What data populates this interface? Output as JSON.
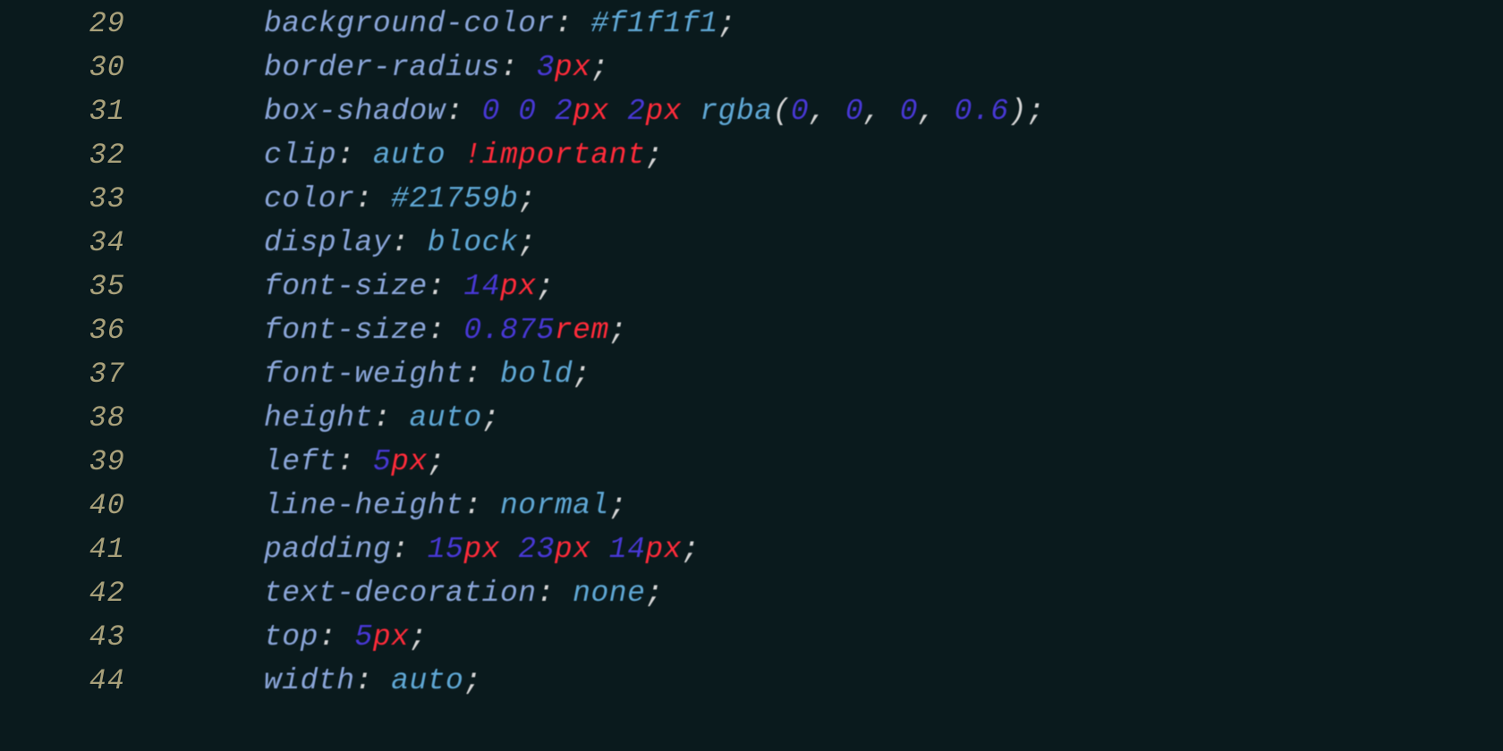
{
  "lines": [
    {
      "num": "29",
      "prop": "background-color",
      "tokens": [
        {
          "t": "#f1f1f1",
          "c": "v"
        }
      ]
    },
    {
      "num": "30",
      "prop": "border-radius",
      "tokens": [
        {
          "t": "3",
          "c": "n"
        },
        {
          "t": "px",
          "c": "u"
        }
      ]
    },
    {
      "num": "31",
      "prop": "box-shadow",
      "tokens": [
        {
          "t": "0",
          "c": "n"
        },
        {
          "t": " ",
          "c": "s"
        },
        {
          "t": "0",
          "c": "n"
        },
        {
          "t": " ",
          "c": "s"
        },
        {
          "t": "2",
          "c": "n"
        },
        {
          "t": "px",
          "c": "u"
        },
        {
          "t": " ",
          "c": "s"
        },
        {
          "t": "2",
          "c": "n"
        },
        {
          "t": "px",
          "c": "u"
        },
        {
          "t": " ",
          "c": "s"
        },
        {
          "t": "rgba",
          "c": "f"
        },
        {
          "t": "(",
          "c": "s"
        },
        {
          "t": "0",
          "c": "n"
        },
        {
          "t": ", ",
          "c": "s"
        },
        {
          "t": "0",
          "c": "n"
        },
        {
          "t": ", ",
          "c": "s"
        },
        {
          "t": "0",
          "c": "n"
        },
        {
          "t": ", ",
          "c": "s"
        },
        {
          "t": "0.6",
          "c": "n"
        },
        {
          "t": ")",
          "c": "s"
        }
      ]
    },
    {
      "num": "32",
      "prop": "clip",
      "tokens": [
        {
          "t": "auto",
          "c": "v"
        },
        {
          "t": " ",
          "c": "s"
        },
        {
          "t": "!important",
          "c": "u"
        }
      ]
    },
    {
      "num": "33",
      "prop": "color",
      "tokens": [
        {
          "t": "#21759b",
          "c": "v"
        }
      ]
    },
    {
      "num": "34",
      "prop": "display",
      "tokens": [
        {
          "t": "block",
          "c": "v"
        }
      ]
    },
    {
      "num": "35",
      "prop": "font-size",
      "tokens": [
        {
          "t": "14",
          "c": "n"
        },
        {
          "t": "px",
          "c": "u"
        }
      ]
    },
    {
      "num": "36",
      "prop": "font-size",
      "tokens": [
        {
          "t": "0.875",
          "c": "n"
        },
        {
          "t": "rem",
          "c": "u"
        }
      ]
    },
    {
      "num": "37",
      "prop": "font-weight",
      "tokens": [
        {
          "t": "bold",
          "c": "v"
        }
      ]
    },
    {
      "num": "38",
      "prop": "height",
      "tokens": [
        {
          "t": "auto",
          "c": "v"
        }
      ]
    },
    {
      "num": "39",
      "prop": "left",
      "tokens": [
        {
          "t": "5",
          "c": "n"
        },
        {
          "t": "px",
          "c": "u"
        }
      ]
    },
    {
      "num": "40",
      "prop": "line-height",
      "tokens": [
        {
          "t": "normal",
          "c": "v"
        }
      ]
    },
    {
      "num": "41",
      "prop": "padding",
      "tokens": [
        {
          "t": "15",
          "c": "n"
        },
        {
          "t": "px",
          "c": "u"
        },
        {
          "t": " ",
          "c": "s"
        },
        {
          "t": "23",
          "c": "n"
        },
        {
          "t": "px",
          "c": "u"
        },
        {
          "t": " ",
          "c": "s"
        },
        {
          "t": "14",
          "c": "n"
        },
        {
          "t": "px",
          "c": "u"
        }
      ]
    },
    {
      "num": "42",
      "prop": "text-decoration",
      "tokens": [
        {
          "t": "none",
          "c": "v"
        }
      ]
    },
    {
      "num": "43",
      "prop": "top",
      "tokens": [
        {
          "t": "5",
          "c": "n"
        },
        {
          "t": "px",
          "c": "u"
        }
      ]
    },
    {
      "num": "44",
      "prop": "width",
      "tokens": [
        {
          "t": "auto",
          "c": "v"
        }
      ]
    }
  ],
  "colon": ": ",
  "semi": ";"
}
